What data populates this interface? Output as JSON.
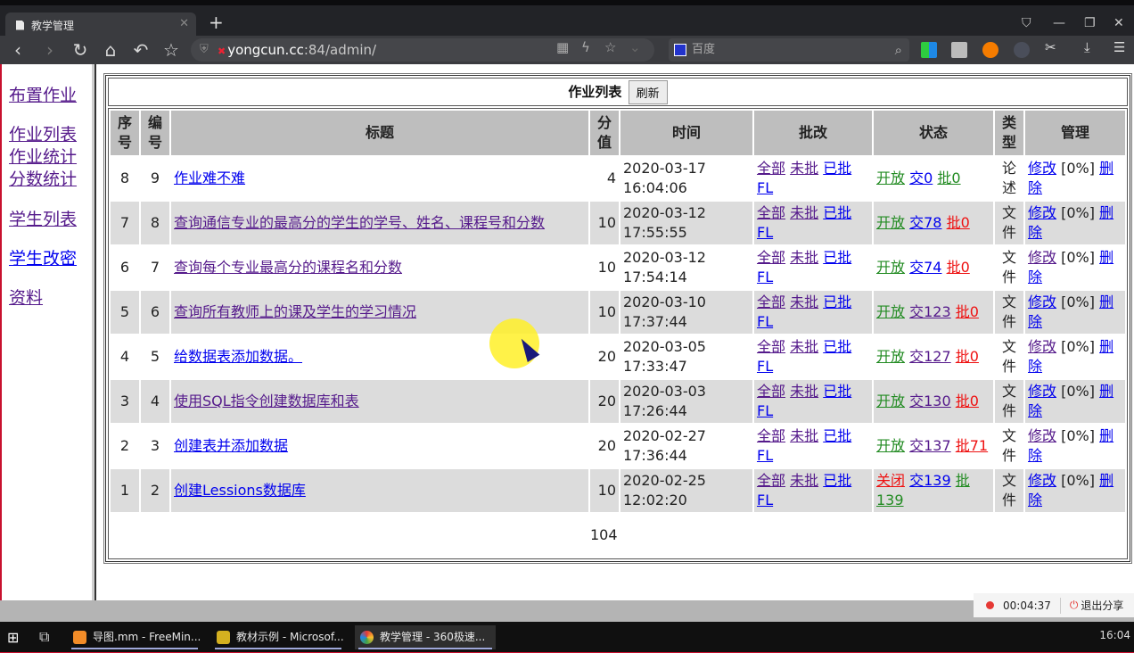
{
  "browser": {
    "tab_title": "教学管理",
    "url_host": "yongcun.cc",
    "url_rest": ":84/admin/",
    "search_placeholder": "百度"
  },
  "sidebar": {
    "items": [
      {
        "label": "布置作业",
        "visited": true
      },
      {
        "label": "作业列表",
        "visited": true
      },
      {
        "label": "作业统计",
        "visited": true
      },
      {
        "label": "分数统计",
        "visited": true
      },
      {
        "label": "学生列表",
        "visited": true
      },
      {
        "label": "学生改密",
        "visited": false
      },
      {
        "label": "资料",
        "visited": true
      }
    ]
  },
  "main": {
    "caption": "作业列表",
    "refresh_label": "刷新",
    "headers": [
      "序号",
      "编号",
      "标题",
      "分值",
      "时间",
      "批改",
      "状态",
      "类型",
      "管理"
    ],
    "grade_links": [
      "全部",
      "未批",
      "已批",
      "FL"
    ],
    "manage": {
      "edit": "修改",
      "percent": "[0%]",
      "delete": "删除"
    },
    "rows": [
      {
        "seq": "8",
        "id": "9",
        "title": "作业难不难",
        "score": "4",
        "date": "2020-03-17",
        "time": "16:04:06",
        "state": "开放",
        "state_color": "green",
        "submitted": "交0",
        "graded": "批0",
        "graded_color": "green",
        "type": "论述"
      },
      {
        "seq": "7",
        "id": "8",
        "title": "查询通信专业的最高分的学生的学号、姓名、课程号和分数",
        "score": "10",
        "date": "2020-03-12",
        "time": "17:55:55",
        "state": "开放",
        "state_color": "green",
        "submitted": "交78",
        "graded": "批0",
        "graded_color": "red",
        "type": "文件"
      },
      {
        "seq": "6",
        "id": "7",
        "title": "查询每个专业最高分的课程名和分数",
        "score": "10",
        "date": "2020-03-12",
        "time": "17:54:14",
        "state": "开放",
        "state_color": "green",
        "submitted": "交74",
        "graded": "批0",
        "graded_color": "red",
        "type": "文件"
      },
      {
        "seq": "5",
        "id": "6",
        "title": "查询所有教师上的课及学生的学习情况",
        "score": "10",
        "date": "2020-03-10",
        "time": "17:37:44",
        "state": "开放",
        "state_color": "green",
        "submitted": "交123",
        "graded": "批0",
        "graded_color": "red",
        "type": "文件"
      },
      {
        "seq": "4",
        "id": "5",
        "title": "给数据表添加数据。",
        "score": "20",
        "date": "2020-03-05",
        "time": "17:33:47",
        "state": "开放",
        "state_color": "green",
        "submitted": "交127",
        "graded": "批0",
        "graded_color": "red",
        "type": "文件"
      },
      {
        "seq": "3",
        "id": "4",
        "title": "使用SQL指令创建数据库和表",
        "score": "20",
        "date": "2020-03-03",
        "time": "17:26:44",
        "state": "开放",
        "state_color": "green",
        "submitted": "交130",
        "graded": "批0",
        "graded_color": "red",
        "type": "文件"
      },
      {
        "seq": "2",
        "id": "3",
        "title": "创建表并添加数据",
        "score": "20",
        "date": "2020-02-27",
        "time": "17:36:44",
        "state": "开放",
        "state_color": "green",
        "submitted": "交137",
        "graded": "批71",
        "graded_color": "red",
        "type": "文件"
      },
      {
        "seq": "1",
        "id": "2",
        "title": "创建Lessions数据库",
        "score": "10",
        "date": "2020-02-25",
        "time": "12:02:20",
        "state": "关闭",
        "state_color": "red",
        "submitted": "交139",
        "graded": "批139",
        "graded_color": "green",
        "type": "文件"
      }
    ],
    "total_score": "104"
  },
  "recording": {
    "elapsed": "00:04:37",
    "exit_label": "退出分享"
  },
  "taskbar": {
    "items": [
      "导图.mm - FreeMin...",
      "教材示例 - Microsof...",
      "教学管理 - 360极速..."
    ],
    "clock": "16:04"
  },
  "colors": {
    "link_blue": "#0000ee",
    "link_visited": "#551a8b",
    "open_green": "#228b22",
    "alert_red": "#ee1111",
    "header_gray": "#bebebe",
    "row_alt": "#dcdcdc"
  }
}
